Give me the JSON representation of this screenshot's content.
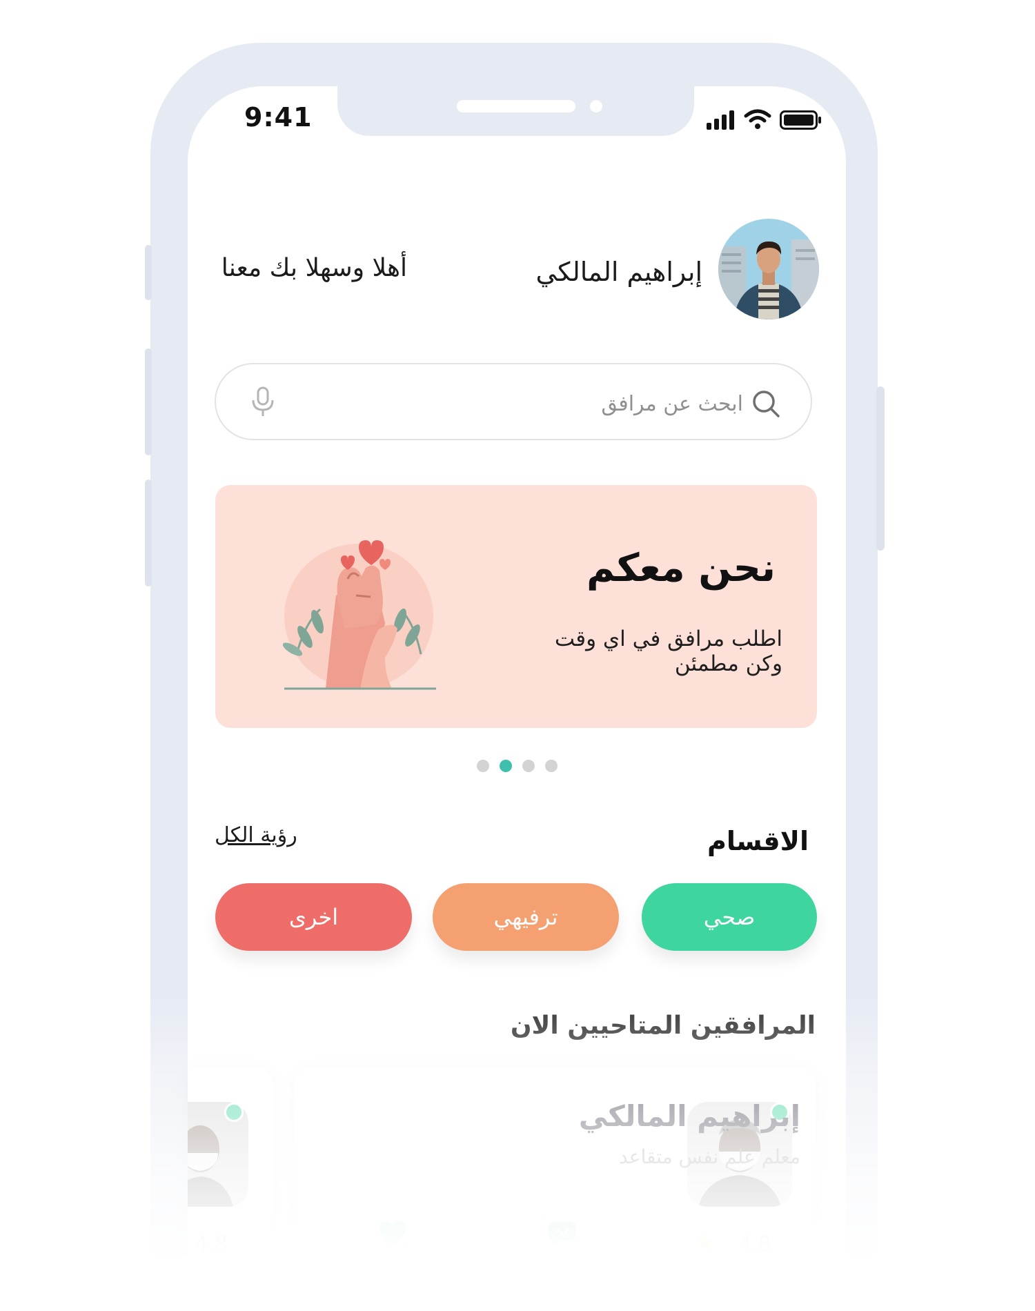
{
  "status_bar": {
    "time": "9:41"
  },
  "header": {
    "user_name": "إبراهيم المالكي",
    "greeting": "أهلا وسهلا بك معنا"
  },
  "search": {
    "placeholder": "ابحث عن مرافق"
  },
  "banner": {
    "title": "نحن معكم",
    "subtitle": "اطلب مرافق في اي وقت وكن مطمئن",
    "pages": 4,
    "active_page": 2
  },
  "categories": {
    "title": "الاقسام",
    "see_all": "رؤية الكل",
    "items": [
      {
        "label": "صحي",
        "color": "#3ed59f"
      },
      {
        "label": "ترفيهي",
        "color": "#f4a071"
      },
      {
        "label": "اخرى",
        "color": "#ef6d68"
      }
    ]
  },
  "available": {
    "title": "المرافقين المتاحيين الان",
    "companions": [
      {
        "name": "إبراهيم المالكي",
        "role": "معلم علم نفس متقاعد",
        "rating": "4.8",
        "online": true
      },
      {
        "rating": "4.8",
        "online": true
      }
    ]
  },
  "colors": {
    "accent": "#3fbfae",
    "banner_bg": "#fde0d7",
    "online": "#3ed59f"
  }
}
